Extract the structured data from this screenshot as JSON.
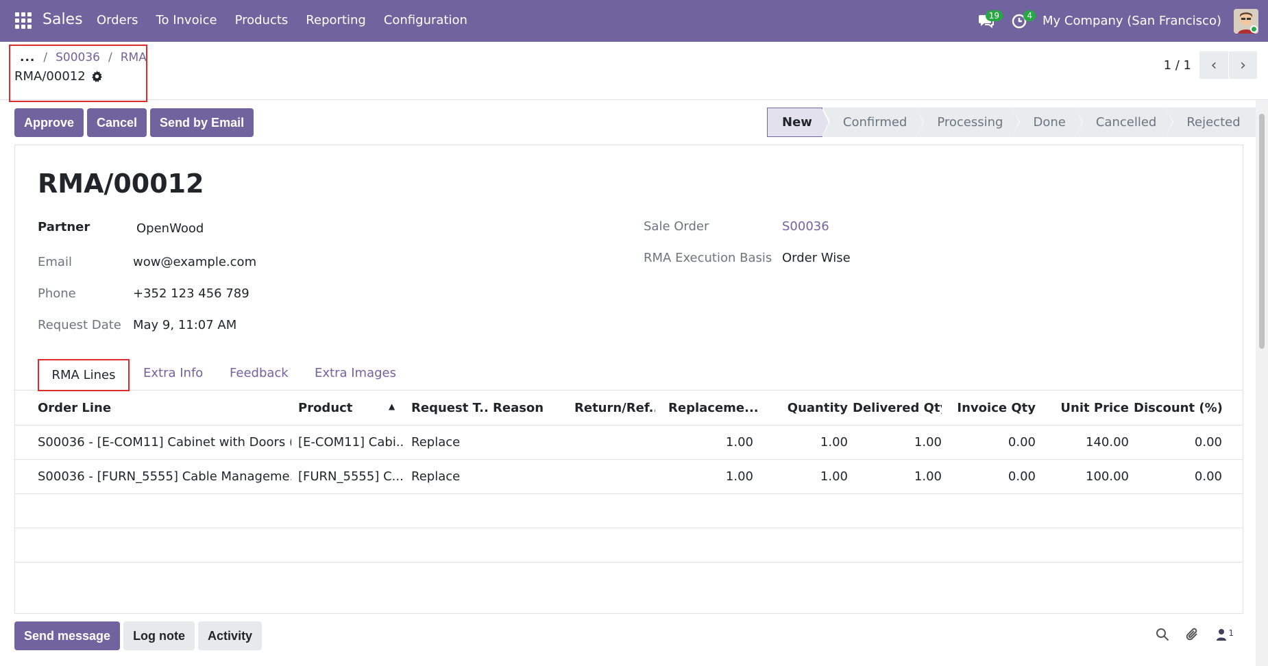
{
  "navbar": {
    "app_name": "Sales",
    "menu": [
      "Orders",
      "To Invoice",
      "Products",
      "Reporting",
      "Configuration"
    ],
    "messages_count": "19",
    "activities_count": "4",
    "company": "My Company (San Francisco)"
  },
  "breadcrumb": {
    "dots": "...",
    "items": [
      "S00036",
      "RMA"
    ],
    "current": "RMA/00012"
  },
  "pager": {
    "value": "1 / 1"
  },
  "actions": {
    "approve": "Approve",
    "cancel": "Cancel",
    "send_email": "Send by Email"
  },
  "statusbar": [
    "New",
    "Confirmed",
    "Processing",
    "Done",
    "Cancelled",
    "Rejected"
  ],
  "record": {
    "title": "RMA/00012",
    "partner_label": "Partner",
    "partner": "OpenWood",
    "email_label": "Email",
    "email": "wow@example.com",
    "phone_label": "Phone",
    "phone": "+352 123 456 789",
    "request_date_label": "Request Date",
    "request_date": "May 9, 11:07 AM",
    "sale_order_label": "Sale Order",
    "sale_order": "S00036",
    "execution_basis_label": "RMA Execution Basis",
    "execution_basis": "Order Wise"
  },
  "tabs": [
    "RMA Lines",
    "Extra Info",
    "Feedback",
    "Extra Images"
  ],
  "table": {
    "headers": [
      "Order Line",
      "Product",
      "Request T...",
      "Reason",
      "Return/Ref...",
      "Replaceme...",
      "Quantity",
      "Delivered Qty",
      "Invoice Qty",
      "Unit Price",
      "Discount (%)"
    ],
    "rows": [
      [
        "S00036 - [E-COM11] Cabinet with Doors (...",
        "[E-COM11] Cabi...",
        "Replace",
        "",
        "",
        "1.00",
        "1.00",
        "1.00",
        "0.00",
        "140.00",
        "0.00"
      ],
      [
        "S00036 - [FURN_5555] Cable Manageme...",
        "[FURN_5555] C...",
        "Replace",
        "",
        "",
        "1.00",
        "1.00",
        "1.00",
        "0.00",
        "100.00",
        "0.00"
      ]
    ]
  },
  "chatter": {
    "send_message": "Send message",
    "log_note": "Log note",
    "activity": "Activity",
    "followers_count": "1"
  }
}
